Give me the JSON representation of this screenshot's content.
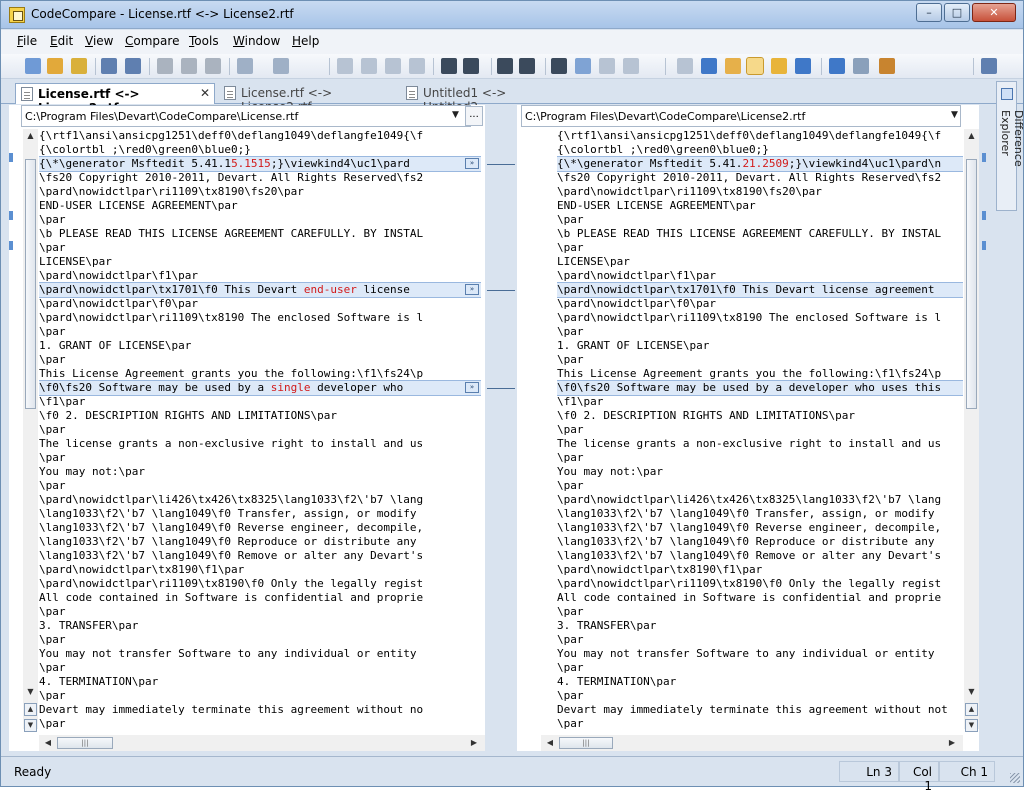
{
  "window": {
    "title": "CodeCompare - License.rtf <-> License2.rtf",
    "min": "–",
    "max": "□",
    "close": "✕"
  },
  "menu": [
    {
      "label": "File",
      "accel": "F",
      "rest": "ile"
    },
    {
      "label": "Edit",
      "accel": "E",
      "rest": "dit"
    },
    {
      "label": "View",
      "accel": "V",
      "rest": "iew"
    },
    {
      "label": "Compare",
      "accel": "C",
      "rest": "ompare"
    },
    {
      "label": "Tools",
      "accel": "T",
      "rest": "ools"
    },
    {
      "label": "Window",
      "accel": "W",
      "rest": "indow"
    },
    {
      "label": "Help",
      "accel": "H",
      "rest": "elp"
    }
  ],
  "toolbar": {
    "icons": [
      "open-compare-icon",
      "open-folder-icon",
      "open-icon",
      "save-icon",
      "save-all-icon",
      "cut-icon",
      "copy-icon",
      "paste-icon",
      "undo-icon",
      "redo-icon",
      "find-icon",
      "find-next-icon",
      "replace-icon",
      "font-icon",
      "align-left-icon",
      "align-right-icon",
      "outline-icon",
      "indent-icon",
      "show-whitespace-icon",
      "comment-icon",
      "comment-next-icon",
      "comment-prev-icon",
      "bookmark-icon",
      "next-diff-icon",
      "prev-diff-icon",
      "sync-edit-icon",
      "star-diff-icon",
      "refresh-icon",
      "swap-icon",
      "options-icon",
      "settings-icon",
      "layout-icon"
    ]
  },
  "tabs": [
    {
      "label": "License.rtf <-> License2.rtf",
      "active": true,
      "close": "✕"
    },
    {
      "label": "License.rtf <-> License2.rtf",
      "active": false
    },
    {
      "label": "Untitled1 <-> Untitled2",
      "active": false
    }
  ],
  "side_panel": {
    "label": "Difference Explorer"
  },
  "left": {
    "path": "C:\\Program Files\\Devart\\CodeCompare\\License.rtf",
    "browse": "...",
    "lines": [
      {
        "t": "{\\rtf1\\ansi\\ansicpg1251\\deff0\\deflang1049\\deflangfe1049{\\f"
      },
      {
        "t": "{\\colortbl ;\\red0\\green0\\blue0;}"
      },
      {
        "pre": "{\\*\\generator Msftedit 5.41.1",
        "chg": "5.1515",
        "post": ";}\\viewkind4\\uc1\\pard",
        "mod": true
      },
      {
        "t": "\\fs20 Copyright 2010-2011, Devart. All Rights Reserved\\fs2"
      },
      {
        "t": "\\pard\\nowidctlpar\\ri1109\\tx8190\\fs20\\par"
      },
      {
        "t": "END-USER LICENSE AGREEMENT\\par"
      },
      {
        "t": "\\par"
      },
      {
        "t": "\\b PLEASE READ THIS LICENSE AGREEMENT CAREFULLY. BY INSTAL"
      },
      {
        "t": "\\par"
      },
      {
        "t": "LICENSE\\par"
      },
      {
        "t": "\\pard\\nowidctlpar\\f1\\par"
      },
      {
        "pre": "\\pard\\nowidctlpar\\tx1701\\f0 This Devart ",
        "chg": "end-user",
        "post": " license",
        "mod": true
      },
      {
        "t": "\\pard\\nowidctlpar\\f0\\par"
      },
      {
        "t": "\\pard\\nowidctlpar\\ri1109\\tx8190 The enclosed Software is l"
      },
      {
        "t": "\\par"
      },
      {
        "t": "1. GRANT OF LICENSE\\par"
      },
      {
        "t": "\\par"
      },
      {
        "t": "This License Agreement grants you the following:\\f1\\fs24\\p"
      },
      {
        "pre": "\\f0\\fs20 Software may be used by a ",
        "chg": "single",
        "post": " developer who",
        "mod": true
      },
      {
        "t": "\\f1\\par"
      },
      {
        "t": "\\f0 2. DESCRIPTION RIGHTS AND LIMITATIONS\\par"
      },
      {
        "t": "\\par"
      },
      {
        "t": "The license grants a non-exclusive right to install and us"
      },
      {
        "t": "\\par"
      },
      {
        "t": "You may not:\\par"
      },
      {
        "t": "\\par"
      },
      {
        "t": "\\pard\\nowidctlpar\\li426\\tx426\\tx8325\\lang1033\\f2\\'b7 \\lang"
      },
      {
        "t": "\\lang1033\\f2\\'b7 \\lang1049\\f0 Transfer, assign, or modify"
      },
      {
        "t": "\\lang1033\\f2\\'b7 \\lang1049\\f0 Reverse engineer, decompile,"
      },
      {
        "t": "\\lang1033\\f2\\'b7 \\lang1049\\f0 Reproduce or distribute any"
      },
      {
        "t": "\\lang1033\\f2\\'b7 \\lang1049\\f0 Remove or alter any Devart's"
      },
      {
        "t": "\\pard\\nowidctlpar\\tx8190\\f1\\par"
      },
      {
        "t": "\\pard\\nowidctlpar\\ri1109\\tx8190\\f0 Only the legally regist"
      },
      {
        "t": "All code contained in Software is confidential and proprie"
      },
      {
        "t": "\\par"
      },
      {
        "t": "3. TRANSFER\\par"
      },
      {
        "t": "\\par"
      },
      {
        "t": "You may not transfer Software to any individual or entity"
      },
      {
        "t": "\\par"
      },
      {
        "t": "4. TERMINATION\\par"
      },
      {
        "t": "\\par"
      },
      {
        "t": "Devart may immediately terminate this agreement without no"
      },
      {
        "t": "\\par"
      }
    ]
  },
  "right": {
    "path": "C:\\Program Files\\Devart\\CodeCompare\\License2.rtf",
    "lines": [
      {
        "t": "{\\rtf1\\ansi\\ansicpg1251\\deff0\\deflang1049\\deflangfe1049{\\f"
      },
      {
        "t": "{\\colortbl ;\\red0\\green0\\blue0;}"
      },
      {
        "pre": "{\\*\\generator Msftedit 5.41.",
        "chg": "21.2509",
        "post": ";}\\viewkind4\\uc1\\pard\\n",
        "mod": true
      },
      {
        "t": "\\fs20 Copyright 2010-2011, Devart. All Rights Reserved\\fs2"
      },
      {
        "t": "\\pard\\nowidctlpar\\ri1109\\tx8190\\fs20\\par"
      },
      {
        "t": "END-USER LICENSE AGREEMENT\\par"
      },
      {
        "t": "\\par"
      },
      {
        "t": "\\b PLEASE READ THIS LICENSE AGREEMENT CAREFULLY. BY INSTAL"
      },
      {
        "t": "\\par"
      },
      {
        "t": "LICENSE\\par"
      },
      {
        "t": "\\pard\\nowidctlpar\\f1\\par"
      },
      {
        "pre": "\\pard\\nowidctlpar\\tx1701\\f0 This Devart license agreement",
        "chg": "",
        "post": "",
        "mod": true
      },
      {
        "t": "\\pard\\nowidctlpar\\f0\\par"
      },
      {
        "t": "\\pard\\nowidctlpar\\ri1109\\tx8190 The enclosed Software is l"
      },
      {
        "t": "\\par"
      },
      {
        "t": "1. GRANT OF LICENSE\\par"
      },
      {
        "t": "\\par"
      },
      {
        "t": "This License Agreement grants you the following:\\f1\\fs24\\p"
      },
      {
        "pre": "\\f0\\fs20 Software may be used by a developer who uses this",
        "chg": "",
        "post": "",
        "mod": true
      },
      {
        "t": "\\f1\\par"
      },
      {
        "t": "\\f0 2. DESCRIPTION RIGHTS AND LIMITATIONS\\par"
      },
      {
        "t": "\\par"
      },
      {
        "t": "The license grants a non-exclusive right to install and us"
      },
      {
        "t": "\\par"
      },
      {
        "t": "You may not:\\par"
      },
      {
        "t": "\\par"
      },
      {
        "t": "\\pard\\nowidctlpar\\li426\\tx426\\tx8325\\lang1033\\f2\\'b7 \\lang"
      },
      {
        "t": "\\lang1033\\f2\\'b7 \\lang1049\\f0 Transfer, assign, or modify"
      },
      {
        "t": "\\lang1033\\f2\\'b7 \\lang1049\\f0 Reverse engineer, decompile,"
      },
      {
        "t": "\\lang1033\\f2\\'b7 \\lang1049\\f0 Reproduce or distribute any"
      },
      {
        "t": "\\lang1033\\f2\\'b7 \\lang1049\\f0 Remove or alter any Devart's"
      },
      {
        "t": "\\pard\\nowidctlpar\\tx8190\\f1\\par"
      },
      {
        "t": "\\pard\\nowidctlpar\\ri1109\\tx8190\\f0 Only the legally regist"
      },
      {
        "t": "All code contained in Software is confidential and proprie"
      },
      {
        "t": "\\par"
      },
      {
        "t": "3. TRANSFER\\par"
      },
      {
        "t": "\\par"
      },
      {
        "t": "You may not transfer Software to any individual or entity"
      },
      {
        "t": "\\par"
      },
      {
        "t": "4. TERMINATION\\par"
      },
      {
        "t": "\\par"
      },
      {
        "t": "Devart may immediately terminate this agreement without not"
      },
      {
        "t": "\\par"
      }
    ]
  },
  "status": {
    "ready": "Ready",
    "ln": "Ln 3",
    "col": "Col 1",
    "ch": "Ch 1"
  },
  "colors": {
    "accent": "#5b8fd1",
    "diff_line": "#dde9f8",
    "diff_text": "#d21a1a"
  }
}
